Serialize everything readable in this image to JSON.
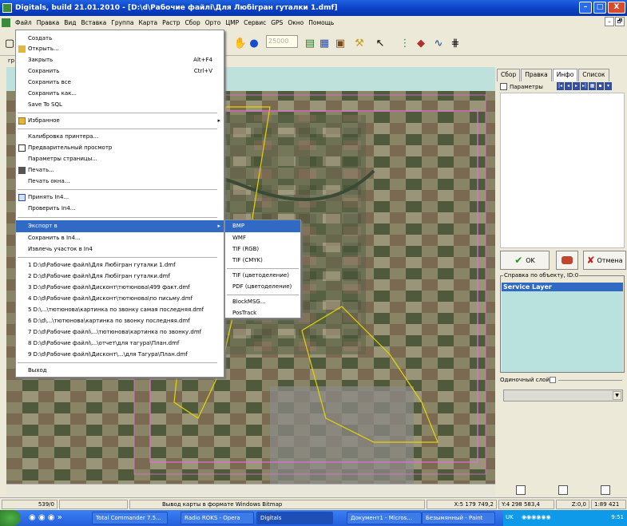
{
  "window": {
    "title": "Digitals, build 21.01.2010 - [D:\\d\\Рабочие файлі\\Для Любігран гуталки 1.dmf]",
    "min": "–",
    "max": "□",
    "close": "X"
  },
  "menubar": [
    "Файл",
    "Правка",
    "Вид",
    "Вставка",
    "Группа",
    "Карта",
    "Растр",
    "Сбор",
    "Орто",
    "ЦМР",
    "Сервис",
    "GPS",
    "Окно",
    "Помощь"
  ],
  "mdi": {
    "min": "–",
    "max": "🗗"
  },
  "toolbar": {
    "scale_value": "25000",
    "tab_label": "гр"
  },
  "file_menu": {
    "items": [
      {
        "label": "Создать"
      },
      {
        "label": "Открыть..."
      },
      {
        "label": "Закрыть",
        "shortcut": "Alt+F4"
      },
      {
        "label": "Сохранить",
        "shortcut": "Ctrl+V"
      },
      {
        "label": "Сохранить все"
      },
      {
        "label": "Сохранить как..."
      },
      {
        "label": "Save To SQL"
      },
      {
        "label": "Избранное"
      },
      {
        "label": "Калибровка принтера..."
      },
      {
        "label": "Предварительный просмотр"
      },
      {
        "label": "Параметры страницы..."
      },
      {
        "label": "Печать..."
      },
      {
        "label": "Печать окна..."
      },
      {
        "label": "Принять In4..."
      },
      {
        "label": "Проверить In4..."
      },
      {
        "label": "Экспорт в"
      },
      {
        "label": "Сохранить в In4..."
      },
      {
        "label": "Извлечь участок в In4"
      },
      {
        "label": "1 D:\\d\\Рабочие файлі\\Для Любігран гуталки 1.dmf"
      },
      {
        "label": "2 D:\\d\\Рабочие файлі\\Для Любігран гуталки.dmf"
      },
      {
        "label": "3 D:\\d\\Рабочие файлі\\Дисконт\\тютюнова\\499 факт.dmf"
      },
      {
        "label": "4 D:\\d\\Рабочие файлі\\Дисконт\\тютюнова\\по письму.dmf"
      },
      {
        "label": "5 D:\\...\\тютюнова\\картинка по звонку самая последняя.dmf"
      },
      {
        "label": "6 D:\\d\\...\\тютюнова\\картинка по звонку последняя.dmf"
      },
      {
        "label": "7 D:\\d\\Рабочие файлі\\...\\тютюнова\\картинка по звонку.dmf"
      },
      {
        "label": "8 D:\\d\\Рабочие файлі\\...\\отчет\\для тагура\\План.dmf"
      },
      {
        "label": "9 D:\\d\\Рабочие файлі\\Дисконт\\...\\для Тагура\\План.dmf"
      },
      {
        "label": "Выход"
      }
    ]
  },
  "export_menu": [
    "BMP",
    "WMF",
    "TIF (RGB)",
    "TIF (CMYK)",
    "TIF (цветоделение)",
    "PDF (цветоделение)",
    "BlockMSG...",
    "PosTrack"
  ],
  "right_panel": {
    "tabs": [
      "Сбор",
      "Правка",
      "Инфо",
      "Список"
    ],
    "params_label": "Параметры",
    "ok_label": "OK",
    "cancel_label": "Отмена",
    "help_legend": "Справка по объекту, ID:0",
    "service_layer": "Service Layer",
    "single_layer": "Одиночный слой"
  },
  "status": {
    "count": "539/0",
    "message": "Вывод карты в формате Windows Bitmap",
    "x": "X:5 179 749,2",
    "y": "Y:4 298 583,4",
    "z": "Z:0,0",
    "scale": "1:89 421"
  },
  "taskbar": {
    "tasks": [
      "Total Commander 7.5...",
      "Radio ROKS - Opera",
      "Digitals",
      "Документ1 - Micros...",
      "Безымянный - Paint"
    ],
    "lang": "UK",
    "time": "9:51"
  },
  "colors": {
    "title_blue": "#0a3fc4",
    "highlight": "#316ac5",
    "map_bg": "#bfe1dc",
    "boundary_yellow": "#e8d400",
    "boundary_pink": "#e070d8"
  }
}
